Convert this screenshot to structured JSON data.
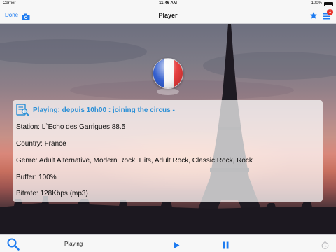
{
  "status_bar": {
    "carrier": "Carrier",
    "time": "11:46 AM",
    "battery": "100%"
  },
  "nav": {
    "title": "Player",
    "done_label": "Done",
    "left_icon": "camera-icon",
    "right_icons": [
      "star-icon",
      "list-icon"
    ],
    "badge_count": "1"
  },
  "station": {
    "flag": "France",
    "playing": "Playing: depuis 10h00 : joining the circus -",
    "rows": [
      "Station: L`Echo des Garrigues 88.5",
      "Country: France",
      "Genre: Adult Alternative, Modern Rock, Hits, Adult Rock, Classic Rock, Rock",
      "Buffer: 100%",
      "Bitrate: 128Kbps (mp3)"
    ]
  },
  "toolbar": {
    "status": "Playing",
    "icons": [
      "search-icon",
      "play-icon",
      "pause-icon",
      "timer-icon"
    ]
  },
  "colors": {
    "accent": "#1d7bf0",
    "playing_text": "#2a8fd6",
    "badge": "#e8342b"
  }
}
